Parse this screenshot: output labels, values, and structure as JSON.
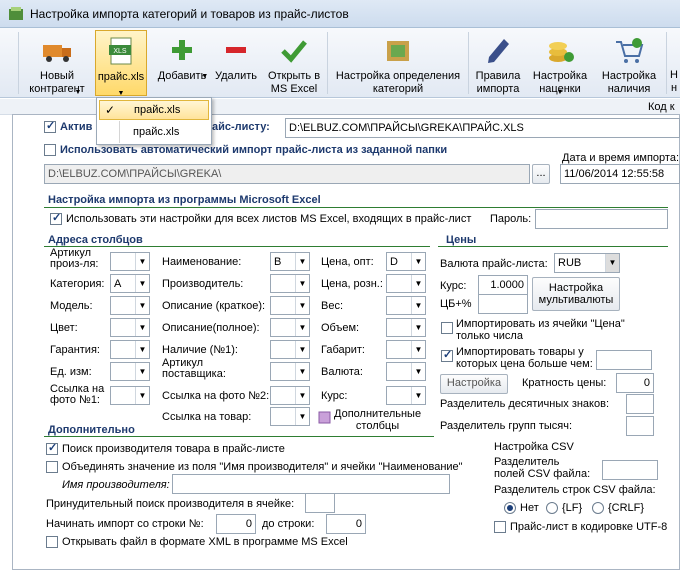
{
  "window": {
    "title": "Настройка импорта категорий и товаров из прайс-листов"
  },
  "toolbar": {
    "new_contractor": "Новый\nконтрагент",
    "price_file": "прайс.xls",
    "add": "Добавить",
    "delete": "Удалить",
    "open_excel": "Открыть в\nMS Excel",
    "category_settings": "Настройка определения\nкатегорий",
    "import_rules": "Правила\nимпорта",
    "markup_settings": "Настройка\nнаценки",
    "stock_settings": "Настройка\nналичия",
    "xls_badge": "XLS"
  },
  "popup": {
    "items": [
      "прайс.xls",
      "прайс.xls"
    ]
  },
  "header_right": "Код к",
  "active": {
    "label": "Актив",
    "suffix": "айс-листу:",
    "path": "D:\\ELBUZ.COM\\ПРАЙСЫ\\GREKA\\ПРАЙС.XLS"
  },
  "auto_import": {
    "label": "Использовать автоматический импорт прайс-листа из заданной папки",
    "path": "D:\\ELBUZ.COM\\ПРАЙСЫ\\GREKA\\",
    "browse": "...",
    "date_label": "Дата и время импорта:",
    "date_value": "11/06/2014 12:55:58"
  },
  "excel": {
    "title": "Настройка импорта из программы Microsoft Excel",
    "use_all": "Использовать эти настройки для всех листов MS Excel, входящих в прайс-лист",
    "password_label": "Пароль:"
  },
  "columns": {
    "title": "Адреса столбцов",
    "article": "Артикул\nпроиз-ля:",
    "category": "Категория:",
    "category_val": "A",
    "model": "Модель:",
    "color": "Цвет:",
    "warranty": "Гарантия:",
    "unit": "Ед. изм:",
    "photo1": "Ссылка на\nфото №1:",
    "name": "Наименование:",
    "name_val": "B",
    "manufacturer": "Производитель:",
    "desc_short": "Описание (краткое):",
    "desc_full": "Описание(полное):",
    "stock": "Наличие (№1):",
    "supplier_article": "Артикул\nпоставщика:",
    "photo2": "Ссылка на фото №2:",
    "product_link": "Ссылка на товар:",
    "price_wholesale": "Цена, опт:",
    "price_wholesale_val": "D",
    "price_retail": "Цена, розн.:",
    "weight": "Вес:",
    "volume": "Объем:",
    "size": "Габарит:",
    "currency": "Валюта:",
    "rate": "Курс:",
    "extra_columns": "Дополнительные\nстолбцы"
  },
  "prices": {
    "title": "Цены",
    "currency_label": "Валюта прайс-листа:",
    "currency_value": "RUB",
    "rate_label": "Курс:",
    "rate_value": "1.0000",
    "cb_label": "ЦБ+%",
    "multi_currency": "Настройка\nмультивалюты",
    "import_price_cell": "Импортировать из ячейки \"Цена\"\nтолько числа",
    "import_more_than": "Импортировать товары у\nкоторых цена больше чем:",
    "settings_btn": "Настройка",
    "multiplicity_label": "Кратность цены:",
    "multiplicity_value": "0",
    "decimal_sep": "Разделитель десятичных знаков:",
    "group_sep": "Разделитель групп тысяч:"
  },
  "extra": {
    "title": "Дополнительно",
    "search_manufacturer": "Поиск производителя товара в прайс-листе",
    "combine": "Объединять значение из поля \"Имя производителя\" и ячейки \"Наименование\"",
    "manufacturer_name": "Имя производителя:",
    "forced_search": "Принудительный поиск производителя в ячейке:",
    "start_row_label": "Начинать импорт со строки №:",
    "start_row_value": "0",
    "to_row_label": "до строки:",
    "to_row_value": "0",
    "open_xml": "Открывать файл в формате XML в программе MS Excel"
  },
  "csv": {
    "title": "Настройка CSV",
    "field_sep": "Разделитель\nполей CSV файла:",
    "row_sep": "Разделитель строк CSV файла:",
    "opt_none": "Нет",
    "opt_lf": "{LF}",
    "opt_crlf": "{CRLF}",
    "utf8": "Прайс-лист в кодировке UTF-8"
  }
}
